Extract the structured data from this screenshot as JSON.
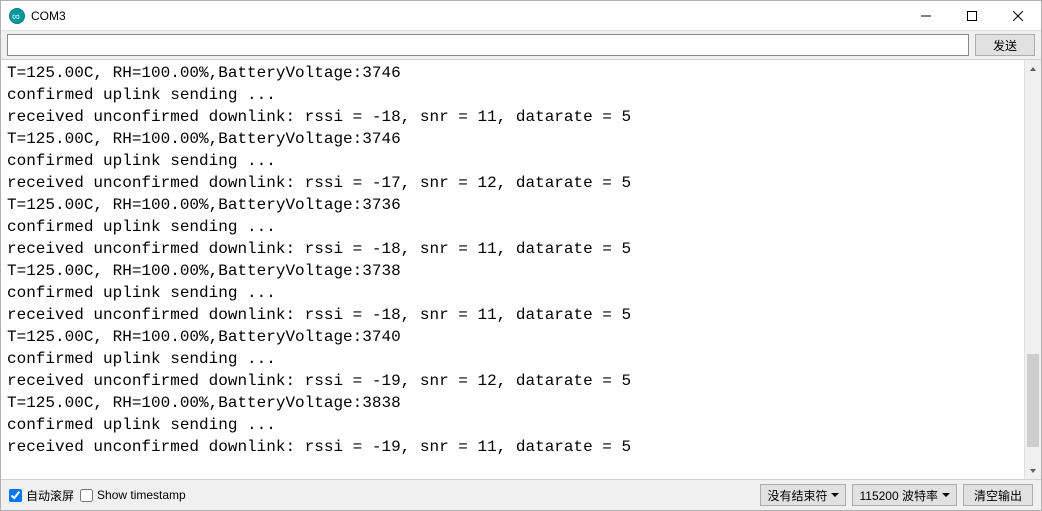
{
  "window": {
    "title": "COM3"
  },
  "send": {
    "input_value": "",
    "button_label": "发送"
  },
  "console_lines": [
    "T=125.00C, RH=100.00%,BatteryVoltage:3746",
    "confirmed uplink sending ...",
    "received unconfirmed downlink: rssi = -18, snr = 11, datarate = 5",
    "T=125.00C, RH=100.00%,BatteryVoltage:3746",
    "confirmed uplink sending ...",
    "received unconfirmed downlink: rssi = -17, snr = 12, datarate = 5",
    "T=125.00C, RH=100.00%,BatteryVoltage:3736",
    "confirmed uplink sending ...",
    "received unconfirmed downlink: rssi = -18, snr = 11, datarate = 5",
    "T=125.00C, RH=100.00%,BatteryVoltage:3738",
    "confirmed uplink sending ...",
    "received unconfirmed downlink: rssi = -18, snr = 11, datarate = 5",
    "T=125.00C, RH=100.00%,BatteryVoltage:3740",
    "confirmed uplink sending ...",
    "received unconfirmed downlink: rssi = -19, snr = 12, datarate = 5",
    "T=125.00C, RH=100.00%,BatteryVoltage:3838",
    "confirmed uplink sending ...",
    "received unconfirmed downlink: rssi = -19, snr = 11, datarate = 5"
  ],
  "bottom": {
    "autoscroll_label": "自动滚屏",
    "autoscroll_checked": true,
    "show_timestamp_label": "Show timestamp",
    "show_timestamp_checked": false,
    "line_ending": "没有结束符",
    "baud": "115200 波特率",
    "clear_label": "清空输出"
  },
  "scrollbar": {
    "thumb_top_pct": 72,
    "thumb_height_pct": 24
  }
}
